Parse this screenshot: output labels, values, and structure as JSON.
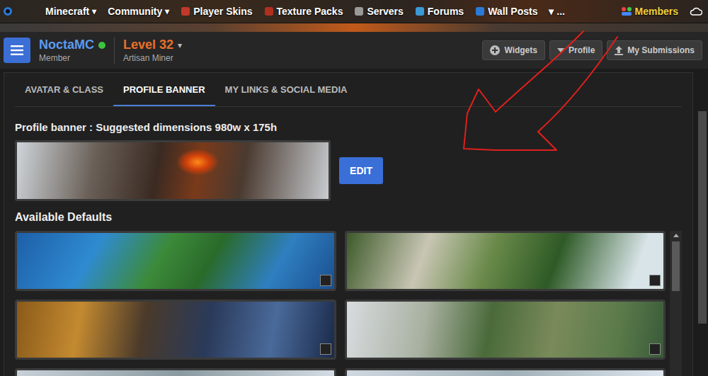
{
  "nav": {
    "items": [
      {
        "label": "Minecraft",
        "caret": "▾",
        "highlighted": false
      },
      {
        "label": "Community",
        "caret": "▾",
        "highlighted": false
      },
      {
        "label": "Player Skins",
        "caret": "",
        "highlighted": false
      },
      {
        "label": "Texture Packs",
        "caret": "",
        "highlighted": false
      },
      {
        "label": "Servers",
        "caret": "",
        "highlighted": false
      },
      {
        "label": "Forums",
        "caret": "",
        "highlighted": false
      },
      {
        "label": "Wall Posts",
        "caret": "",
        "highlighted": false
      },
      {
        "label": "▾ ...",
        "caret": "",
        "highlighted": false
      },
      {
        "label": "Members",
        "caret": "",
        "highlighted": true
      }
    ]
  },
  "user": {
    "name": "NoctaMC",
    "online": true,
    "role": "Member",
    "level": "Level 32",
    "level_caret": "▾",
    "title": "Artisan Miner"
  },
  "toolbar": [
    "Widgets",
    "Profile",
    "My Submissions"
  ],
  "tabs": [
    {
      "label": "AVATAR & CLASS",
      "selected": false
    },
    {
      "label": "PROFILE BANNER",
      "selected": true
    },
    {
      "label": "MY LINKS & SOCIAL MEDIA",
      "selected": false
    }
  ],
  "banner": {
    "heading": "Profile banner : Suggested dimensions 980w x 175h",
    "edit": "EDIT"
  },
  "defaults": {
    "heading": "Available Defaults",
    "items": [
      {
        "badge": true
      },
      {
        "badge": true
      },
      {
        "badge": true
      },
      {
        "badge": true
      },
      {
        "badge": false
      },
      {
        "badge": false
      }
    ]
  }
}
